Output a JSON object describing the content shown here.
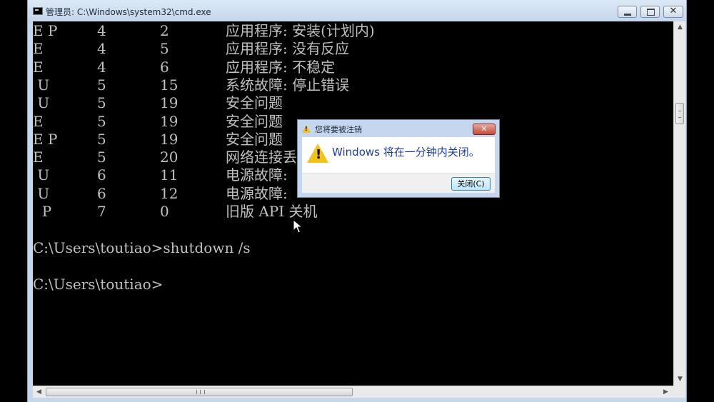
{
  "window": {
    "title": "管理员: C:\\Windows\\system32\\cmd.exe",
    "close_glyph": "✕"
  },
  "console": {
    "table_rows": [
      [
        "E P",
        "4",
        "2",
        "应用程序: 安装(计划内)"
      ],
      [
        "E",
        "4",
        "5",
        "应用程序: 没有反应"
      ],
      [
        "E",
        "4",
        "6",
        "应用程序: 不稳定"
      ],
      [
        " U",
        "5",
        "15",
        "系统故障: 停止错误"
      ],
      [
        " U",
        "5",
        "19",
        "安全问题"
      ],
      [
        "E",
        "5",
        "19",
        "安全问题"
      ],
      [
        "E P",
        "5",
        "19",
        "安全问题"
      ],
      [
        "E",
        "5",
        "20",
        "网络连接丢"
      ],
      [
        " U",
        "6",
        "11",
        "电源故障:"
      ],
      [
        " U",
        "6",
        "12",
        "电源故障:"
      ],
      [
        "  P",
        "7",
        "0",
        "旧版 API 关机"
      ]
    ],
    "prompt1": "C:\\Users\\toutiao>shutdown /s",
    "prompt2": "C:\\Users\\toutiao>"
  },
  "dialog": {
    "title": "您将要被注销",
    "message": "Windows 将在一分钟内关闭。",
    "ok_label": "关闭(C)",
    "close_glyph": "✕",
    "warn_glyph": "!"
  },
  "scrollbars": {
    "up_arrow": "▲",
    "down_arrow": "▼",
    "left_arrow": "◀",
    "right_arrow": "▶"
  }
}
